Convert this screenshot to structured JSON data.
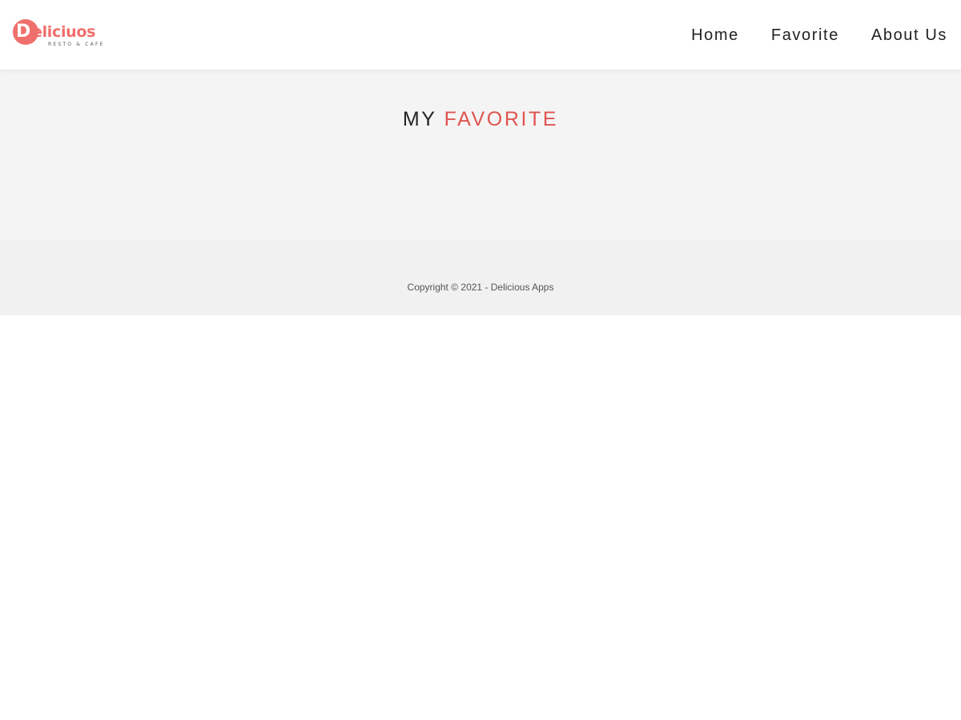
{
  "header": {
    "logo": {
      "initial": "D",
      "word": "eliciuos",
      "tagline": "RESTO & CAFE"
    },
    "nav": [
      {
        "label": "Home"
      },
      {
        "label": "Favorite"
      },
      {
        "label": "About Us"
      }
    ]
  },
  "main": {
    "title_part1": "MY",
    "title_part2": "FAVORITE"
  },
  "footer": {
    "copyright": "Copyright © 2021 - Delicious Apps"
  },
  "colors": {
    "accent": "#e0544f",
    "logo": "#ef6f6c",
    "main_background": "#f4f4f4",
    "footer_background": "#f1f1f1",
    "text_dark": "#222222"
  }
}
